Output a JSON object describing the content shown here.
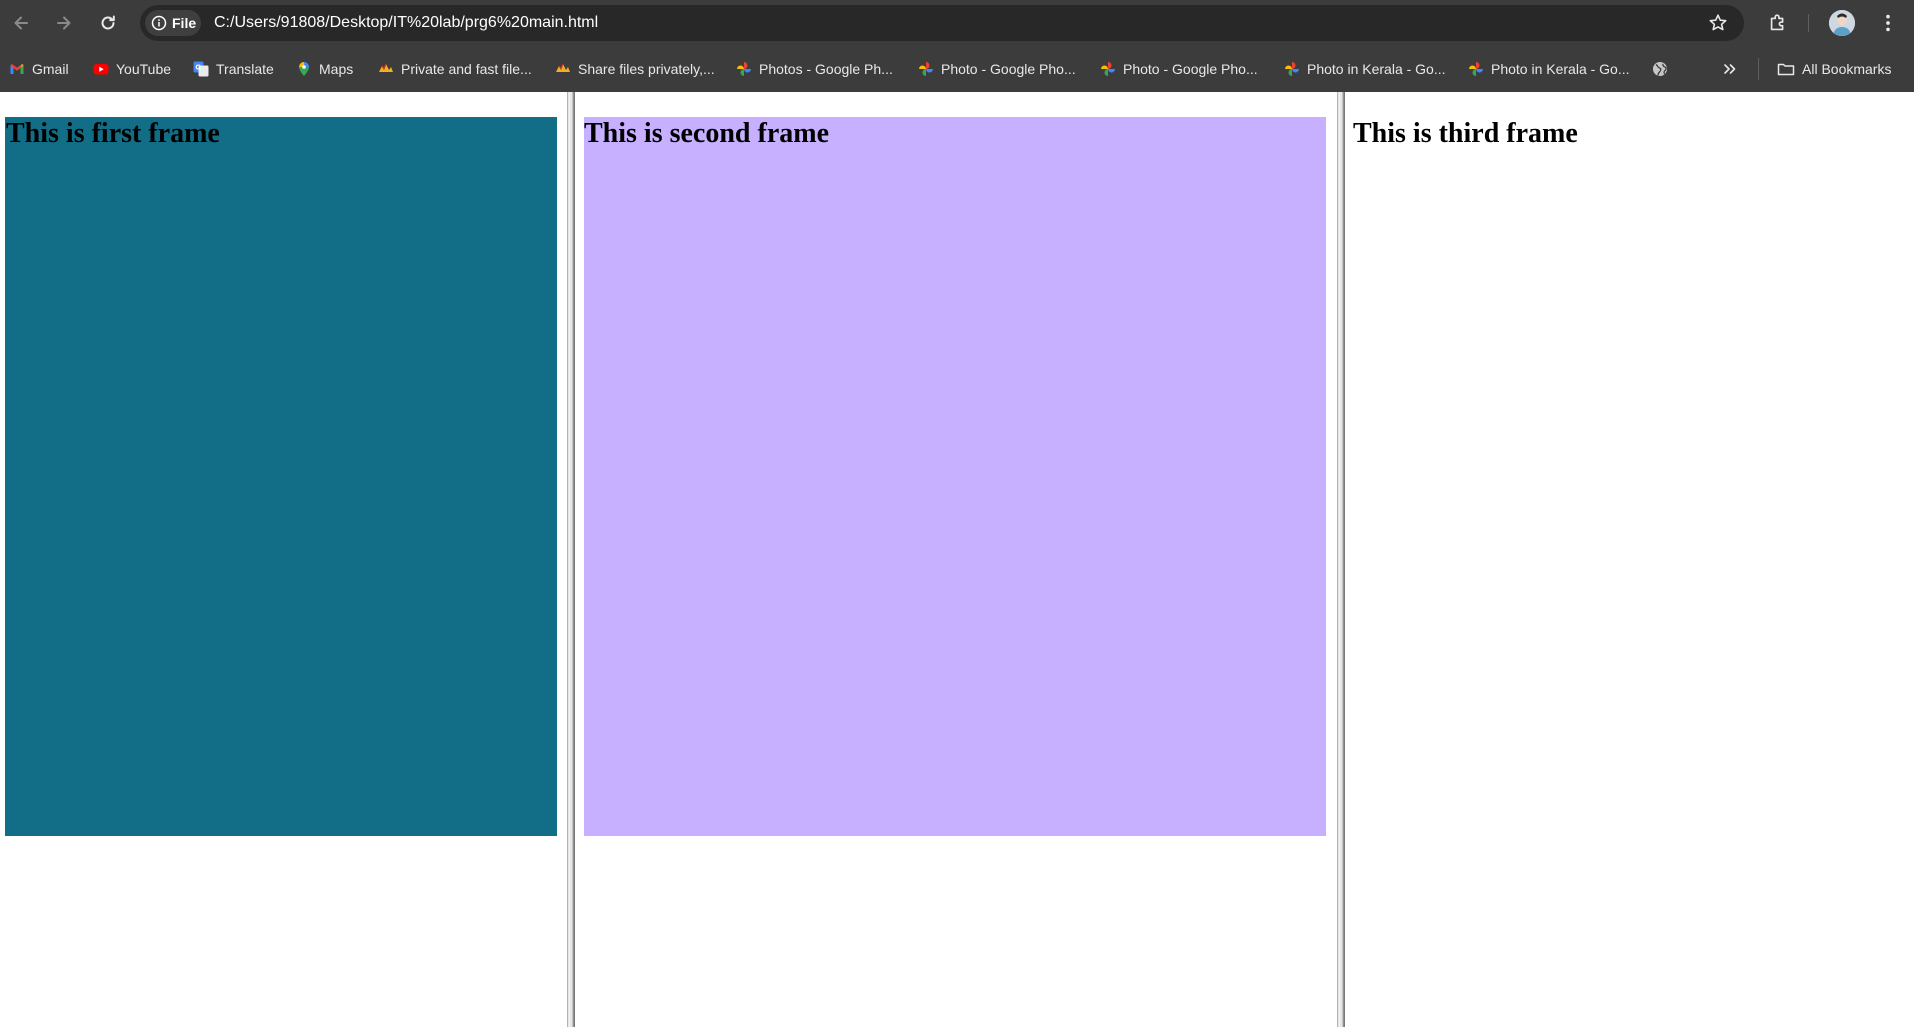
{
  "browser": {
    "address_bar": {
      "scheme_chip": "File",
      "url": "C:/Users/91808/Desktop/IT%20lab/prg6%20main.html"
    },
    "icons": {
      "back": "arrow-left-icon",
      "forward": "arrow-right-icon",
      "reload": "reload-icon",
      "info": "info-icon",
      "bookmark_star": "star-icon",
      "extensions": "puzzle-icon",
      "profile": "avatar",
      "menu": "kebab-menu-icon"
    },
    "colors": {
      "toolbar_bg": "#3c3c3c",
      "omnibox_bg": "#282828"
    }
  },
  "bookmarks": {
    "items": [
      {
        "label": "Gmail",
        "icon": "gmail-icon"
      },
      {
        "label": "YouTube",
        "icon": "youtube-icon"
      },
      {
        "label": "Translate",
        "icon": "translate-icon"
      },
      {
        "label": "Maps",
        "icon": "maps-pin-icon"
      },
      {
        "label": "Private and fast file...",
        "icon": "file-share-icon"
      },
      {
        "label": "Share files privately,...",
        "icon": "file-share-icon"
      },
      {
        "label": "Photos - Google Ph...",
        "icon": "google-photos-icon"
      },
      {
        "label": "Photo - Google Pho...",
        "icon": "google-photos-icon"
      },
      {
        "label": "Photo - Google Pho...",
        "icon": "google-photos-icon"
      },
      {
        "label": "Photo in Kerala - Go...",
        "icon": "google-photos-icon"
      },
      {
        "label": "Photo in Kerala - Go...",
        "icon": "google-photos-icon"
      }
    ],
    "globe_icon": "globe-icon",
    "overflow_icon": "chevron-double-right-icon",
    "all_bookmarks": {
      "label": "All Bookmarks",
      "icon": "folder-icon"
    }
  },
  "frames": [
    {
      "heading": "This is first frame",
      "bg_color": "#126e86"
    },
    {
      "heading": "This is second frame",
      "bg_color": "#c6b0ff"
    },
    {
      "heading": "This is third frame",
      "bg_color": "#ffffff"
    }
  ]
}
